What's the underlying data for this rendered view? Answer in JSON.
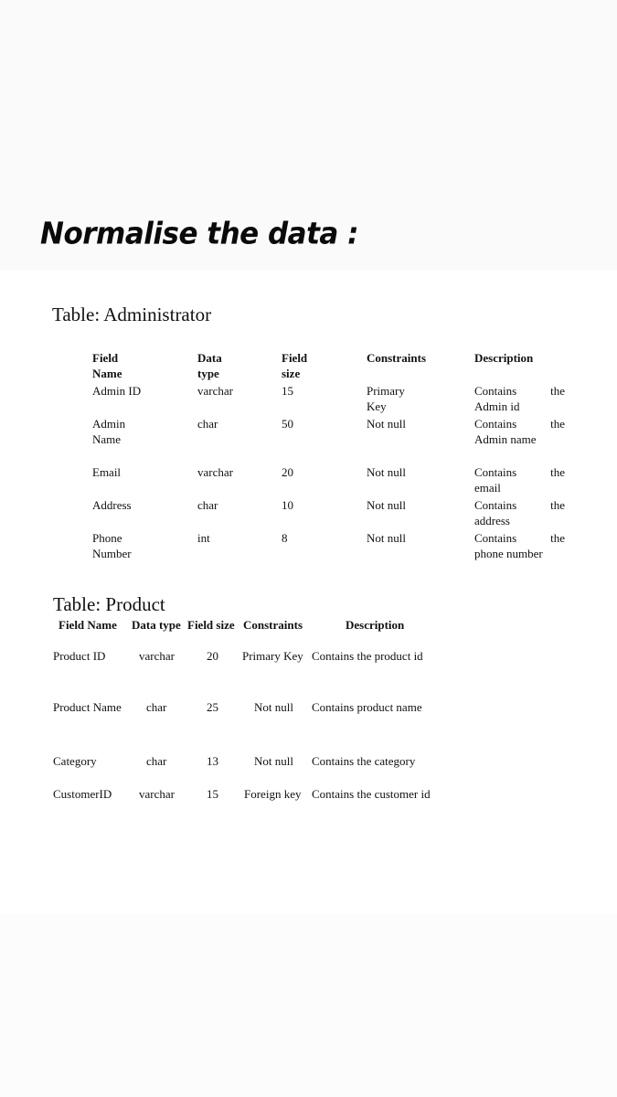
{
  "page": {
    "title": "Normalise the data :"
  },
  "administrator": {
    "title": "Table: Administrator",
    "headers": {
      "field_name_1": "Field",
      "field_name_2": "Name",
      "data_type_1": "Data",
      "data_type_2": "type",
      "field_size_1": "Field",
      "field_size_2": "size",
      "constraints": "Constraints",
      "description": "Description"
    },
    "rows": [
      {
        "field_name": [
          "Admin ID"
        ],
        "data_type": "varchar",
        "field_size": "15",
        "constraints": [
          "Primary",
          "Key"
        ],
        "description": [
          "Contains",
          "the",
          "Admin id"
        ]
      },
      {
        "field_name": [
          "Admin",
          "Name"
        ],
        "data_type": "char",
        "field_size": "50",
        "constraints": [
          "Not null"
        ],
        "description": [
          "Contains",
          "the",
          "Admin name"
        ]
      },
      {
        "field_name": [
          "Email"
        ],
        "data_type": "varchar",
        "field_size": "20",
        "constraints": [
          "Not null"
        ],
        "description": [
          "Contains",
          "the",
          "email"
        ]
      },
      {
        "field_name": [
          "Address"
        ],
        "data_type": "char",
        "field_size": "10",
        "constraints": [
          "Not null"
        ],
        "description": [
          "Contains",
          "the",
          "address"
        ]
      },
      {
        "field_name": [
          "Phone",
          "Number"
        ],
        "data_type": "int",
        "field_size": "8",
        "constraints": [
          "Not null"
        ],
        "description": [
          "Contains",
          "the",
          "phone number"
        ]
      }
    ]
  },
  "product": {
    "title": "Table: Product",
    "headers": {
      "field_name": "Field Name",
      "data_type": "Data type",
      "field_size": "Field size",
      "constraints": "Constraints",
      "description": "Description"
    },
    "rows": [
      {
        "field_name": "Product ID",
        "data_type": "varchar",
        "field_size": "20",
        "constraints": "Primary Key",
        "description": "Contains the product id"
      },
      {
        "field_name": "Product Name",
        "data_type": "char",
        "field_size": "25",
        "constraints": "Not null",
        "description": "Contains product name"
      },
      {
        "field_name": "Category",
        "data_type": "char",
        "field_size": "13",
        "constraints": "Not null",
        "description": "Contains the category"
      },
      {
        "field_name": "CustomerID",
        "data_type": "varchar",
        "field_size": "15",
        "constraints": "Foreign key",
        "description": "Contains the customer id"
      }
    ]
  }
}
